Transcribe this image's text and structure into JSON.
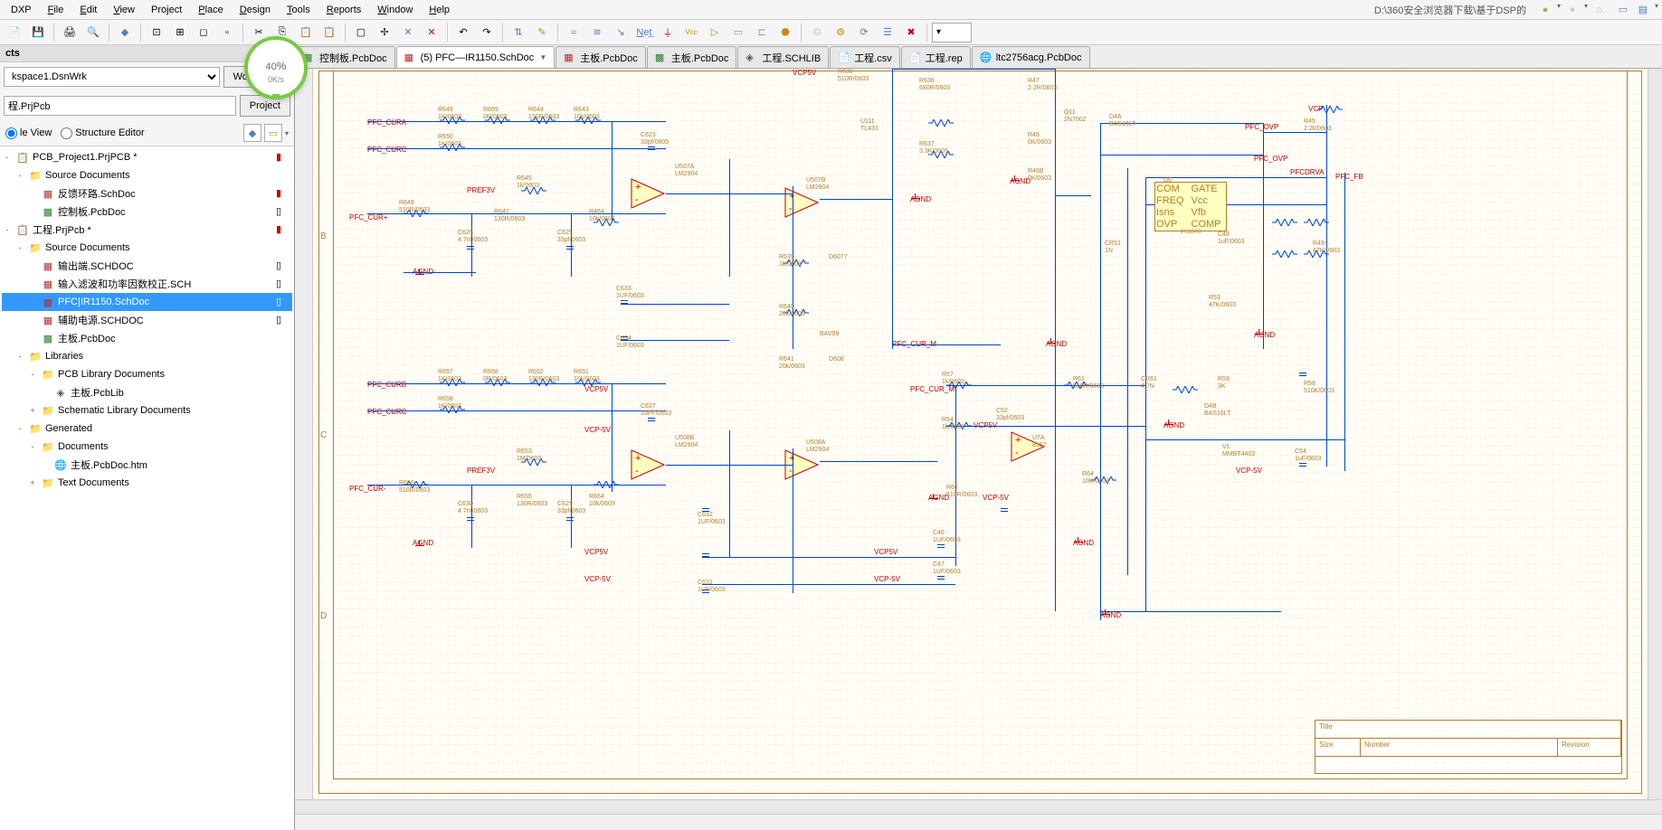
{
  "menu": {
    "items": [
      "DXP",
      "File",
      "Edit",
      "View",
      "Project",
      "Place",
      "Design",
      "Tools",
      "Reports",
      "Window",
      "Help"
    ],
    "path": "D:\\360安全浏览器下载\\基于DSP的"
  },
  "speed": {
    "percent": "40",
    "unit": "%",
    "rate": "0K/s"
  },
  "toolbar": {
    "zoom_value": ""
  },
  "left": {
    "panel_title": "cts",
    "workspace_value": "kspace1.DsnWrk",
    "workspace_btn": "Workspa...",
    "project_value": "程.PrjPcb",
    "project_btn": "Project",
    "file_view": "le View",
    "structure_editor": "Structure Editor",
    "tree": [
      {
        "indent": 0,
        "exp": "-",
        "icon": "proj",
        "label": "PCB_Project1.PrjPCB *",
        "status": "mod"
      },
      {
        "indent": 1,
        "exp": "-",
        "icon": "folder",
        "label": "Source Documents",
        "status": ""
      },
      {
        "indent": 2,
        "exp": "",
        "icon": "sch",
        "label": "反馈环路.SchDoc",
        "status": "mod"
      },
      {
        "indent": 2,
        "exp": "",
        "icon": "pcb",
        "label": "控制板.PcbDoc",
        "status": "doc"
      },
      {
        "indent": 0,
        "exp": "-",
        "icon": "proj",
        "label": "工程.PrjPcb *",
        "status": "mod"
      },
      {
        "indent": 1,
        "exp": "-",
        "icon": "folder",
        "label": "Source Documents",
        "status": ""
      },
      {
        "indent": 2,
        "exp": "",
        "icon": "sch",
        "label": "输出端.SCHDOC",
        "status": "doc"
      },
      {
        "indent": 2,
        "exp": "",
        "icon": "sch",
        "label": "输入滤波和功率因数校正.SCH",
        "status": "doc"
      },
      {
        "indent": 2,
        "exp": "",
        "icon": "sch",
        "label": "PFC|IR1150.SchDoc",
        "status": "doc",
        "selected": true
      },
      {
        "indent": 2,
        "exp": "",
        "icon": "sch",
        "label": "辅助电源.SCHDOC",
        "status": "doc"
      },
      {
        "indent": 2,
        "exp": "",
        "icon": "pcb",
        "label": "主板.PcbDoc",
        "status": ""
      },
      {
        "indent": 1,
        "exp": "-",
        "icon": "folder",
        "label": "Libraries",
        "status": ""
      },
      {
        "indent": 2,
        "exp": "-",
        "icon": "folder",
        "label": "PCB Library Documents",
        "status": ""
      },
      {
        "indent": 3,
        "exp": "",
        "icon": "lib",
        "label": "主板.PcbLib",
        "status": ""
      },
      {
        "indent": 2,
        "exp": "+",
        "icon": "folder",
        "label": "Schematic Library Documents",
        "status": ""
      },
      {
        "indent": 1,
        "exp": "-",
        "icon": "folder",
        "label": "Generated",
        "status": ""
      },
      {
        "indent": 2,
        "exp": "-",
        "icon": "folder",
        "label": "Documents",
        "status": ""
      },
      {
        "indent": 3,
        "exp": "",
        "icon": "html",
        "label": "主板.PcbDoc.htm",
        "status": ""
      },
      {
        "indent": 2,
        "exp": "+",
        "icon": "folder",
        "label": "Text Documents",
        "status": ""
      }
    ]
  },
  "tabs": [
    {
      "icon": "pcb",
      "label": "控制板.PcbDoc",
      "active": false
    },
    {
      "icon": "sch",
      "label": "(5) PFC—IR1150.SchDoc",
      "active": true,
      "dd": true
    },
    {
      "icon": "sch",
      "label": "主板.PcbDoc",
      "active": false
    },
    {
      "icon": "pcb",
      "label": "主板.PcbDoc",
      "active": false
    },
    {
      "icon": "lib",
      "label": "工程.SCHLIB",
      "active": false
    },
    {
      "icon": "csv",
      "label": "工程.csv",
      "active": false
    },
    {
      "icon": "rep",
      "label": "工程.rep",
      "active": false
    },
    {
      "icon": "html",
      "label": "ltc2756acg.PcbDoc",
      "active": false
    }
  ],
  "schematic": {
    "net_labels": [
      "PFC_CURA",
      "PFC_CURC",
      "PREF3V",
      "PFC_CUR+",
      "AGND",
      "VCP5V",
      "VCP-5V",
      "PFC_CURB",
      "PFC_CUR-",
      "PFC_CUR_M",
      "PFC_OVP",
      "PFCDRVA",
      "PFC_FB",
      "VCP"
    ],
    "components": {
      "R649": "1K/0603",
      "R669": "0R/0603",
      "R644": "130R/0603",
      "R643": "10k/0603",
      "R650": "1K/0603",
      "R648": "510R/0603",
      "R645": "1k/0603",
      "R647": "130R/0603",
      "R464": "10k/0603",
      "C626": "4.7nf/0603",
      "C625": "33pf/0603",
      "C623": "33pf/0805",
      "U507A": "LM2904",
      "U507B": "LM2904",
      "R639": "1k/0603",
      "R640": "20k/0603",
      "R641": "20k/0603",
      "D6077": "",
      "D608": "",
      "BAV99": "",
      "R657": "1K/0603",
      "R668": "0R/0603",
      "R652": "130R/0603",
      "R651": "10k/0603",
      "R658": "1K/0603",
      "C627": "33PF/0603",
      "R653": "1M/0603",
      "R656": "510R/0603",
      "R655": "130R/0603",
      "R654": "10k/0603",
      "C630": "4.7nf/0603",
      "C629": "33pf/0603",
      "C632": "1UF/0603",
      "C633": "1UF/0603",
      "C634": "1UF/0603",
      "C631": "1UF/0603",
      "C46": "1UF/0603",
      "C47": "1UF/0603",
      "U508A": "LM2904",
      "U508B": "LM2904",
      "U111": "TL431",
      "R636": "680R/0603",
      "R637": "3.3K/0603",
      "R638": "510R/0603",
      "R47": "2.2R/0603",
      "Q11": "2N7002",
      "D4A": "BAS16LT",
      "R48": "0K/0603",
      "R46B": "0K/0603",
      "R57": "1k/0603",
      "R54": "1k/0603",
      "R66": "510R/0603",
      "C52": "33pf/0603",
      "U7A": "8552",
      "R61": "510R/0603",
      "R64": "10K/0603",
      "CR61": "4.7N",
      "R59": "3K",
      "R58": "510K/0603",
      "D4B": "BAS16LT",
      "V1": "MMBT4403",
      "C54": "1uF/0603",
      "C48": "1uF/0603",
      "U6": "IR1150S",
      "R49": "47K/0603",
      "R45": "2.2k/0603",
      "CR51": "1N",
      "R53": "47K/0603"
    },
    "ic_pins": {
      "U6": [
        "COM",
        "GATE",
        "FREQ",
        "Vcc",
        "Isns",
        "Vfb",
        "OVP",
        "COMP"
      ]
    },
    "title_block": {
      "title": "Title",
      "size": "Size",
      "number": "Number",
      "revision": "Revision"
    }
  },
  "status": ""
}
